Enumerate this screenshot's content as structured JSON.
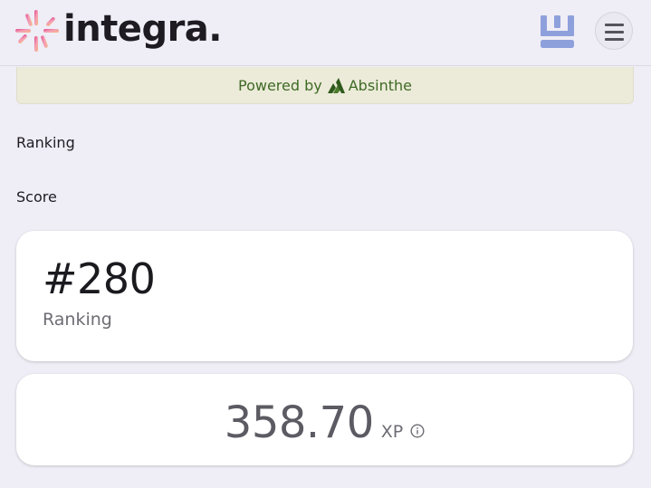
{
  "header": {
    "brand": "integra.",
    "icons": {
      "logo": "integra-logo-mark",
      "app": "app-icon",
      "menu": "hamburger-menu-icon"
    }
  },
  "banner": {
    "powered_by": "Powered by",
    "partner": "Absinthe",
    "partner_icon": "absinthe-logo-icon",
    "color": "#3f6a26"
  },
  "sections": {
    "ranking_label": "Ranking",
    "score_label": "Score"
  },
  "ranking_card": {
    "value": "#280",
    "label": "Ranking"
  },
  "score_card": {
    "value": "358.70",
    "unit": "XP",
    "icon": "info-icon"
  },
  "colors": {
    "background": "#efedf5",
    "card": "#ffffff",
    "accent": "#8ea0dc"
  }
}
